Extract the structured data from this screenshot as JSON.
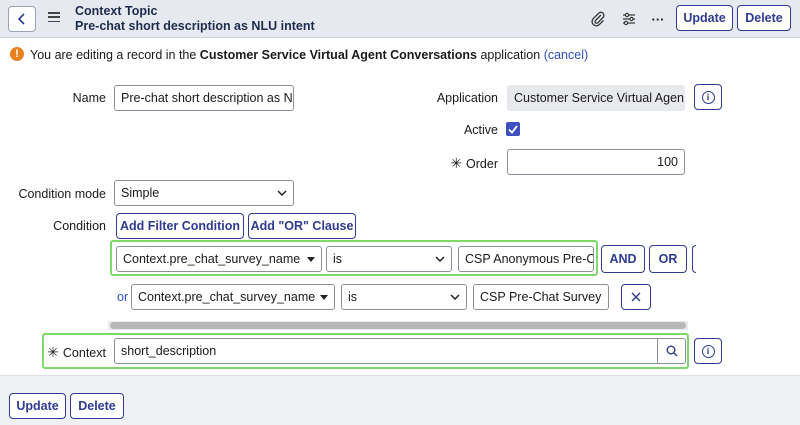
{
  "header": {
    "title": "Context Topic",
    "subtitle": "Pre-chat short description as NLU intent",
    "update_label": "Update",
    "delete_label": "Delete",
    "more_label": "···"
  },
  "banner": {
    "prefix": "You are editing a record in the ",
    "app_name": "Customer Service Virtual Agent Conversations",
    "suffix": " application ",
    "cancel_link": "(cancel)"
  },
  "form": {
    "name_label": "Name",
    "name_value": "Pre-chat short description as NLU intent",
    "application_label": "Application",
    "application_value": "Customer Service Virtual Agent Conversations",
    "active_label": "Active",
    "active_checked": true,
    "order_label": "Order",
    "order_value": "100",
    "condition_mode_label": "Condition mode",
    "condition_mode_value": "Simple",
    "condition_label": "Condition",
    "add_filter_label": "Add Filter Condition",
    "add_or_label": "Add \"OR\" Clause",
    "conditions": [
      {
        "field": "Context.pre_chat_survey_name",
        "operator": "is",
        "value": "CSP Anonymous Pre-Chat Survey",
        "and_label": "AND",
        "or_label": "OR"
      },
      {
        "prefix": "or",
        "field": "Context.pre_chat_survey_name",
        "operator": "is",
        "value": "CSP Pre-Chat Survey"
      }
    ],
    "context_label": "Context",
    "context_value": "short_description"
  },
  "footer": {
    "update_label": "Update",
    "delete_label": "Delete"
  },
  "colors": {
    "accent": "#2e3b8f",
    "highlight": "#7fd96a",
    "warning": "#e8821e",
    "link": "#2e4fb5"
  }
}
